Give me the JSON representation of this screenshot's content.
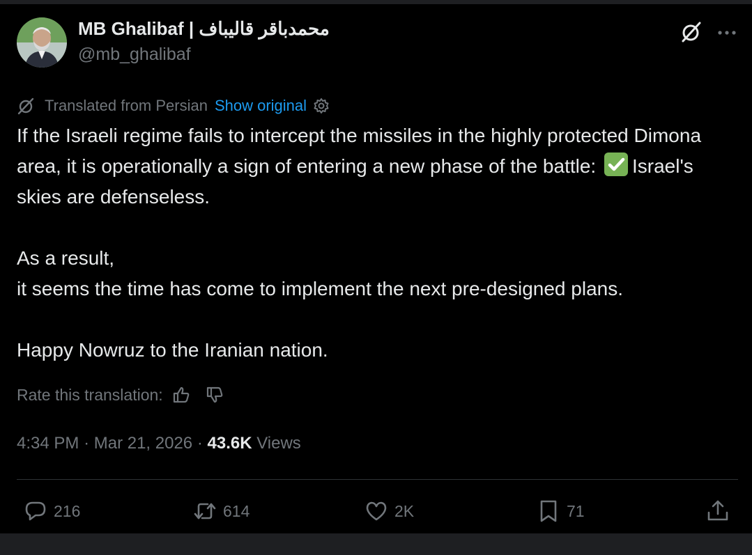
{
  "author": {
    "display_name": "محمدباقر قالیباف | MB Ghalibaf",
    "handle": "@mb_ghalibaf"
  },
  "header": {
    "grok_icon": "slashed-circle-icon",
    "more_icon": "ellipsis-icon"
  },
  "translation": {
    "label": "Translated from Persian",
    "show_original": "Show original"
  },
  "tweet": {
    "paragraph_1_part_1": "If the Israeli regime fails to intercept the missiles in the highly protected Dimona area, it is operationally a sign of entering a new phase of the battle:",
    "paragraph_1_part_2": "Israel's skies are defenseless.",
    "paragraph_2_line_1": "As a result,",
    "paragraph_2_line_2": "it seems the time has come to implement the next pre-designed plans.",
    "paragraph_3": "Happy Nowruz to the Iranian nation."
  },
  "rate": {
    "label": "Rate this translation:"
  },
  "meta": {
    "time": "4:34 PM",
    "separator": "·",
    "date": "Mar 21, 2026",
    "views_count": "43.6K",
    "views_label": "Views"
  },
  "actions": {
    "replies": "216",
    "reposts": "614",
    "likes": "2K",
    "bookmarks": "71"
  },
  "colors": {
    "background": "#000000",
    "text_primary": "#e7e9ea",
    "text_secondary": "#71767b",
    "link": "#1d9bf0",
    "divider": "#2f3336",
    "check_emoji": "#77b255"
  }
}
